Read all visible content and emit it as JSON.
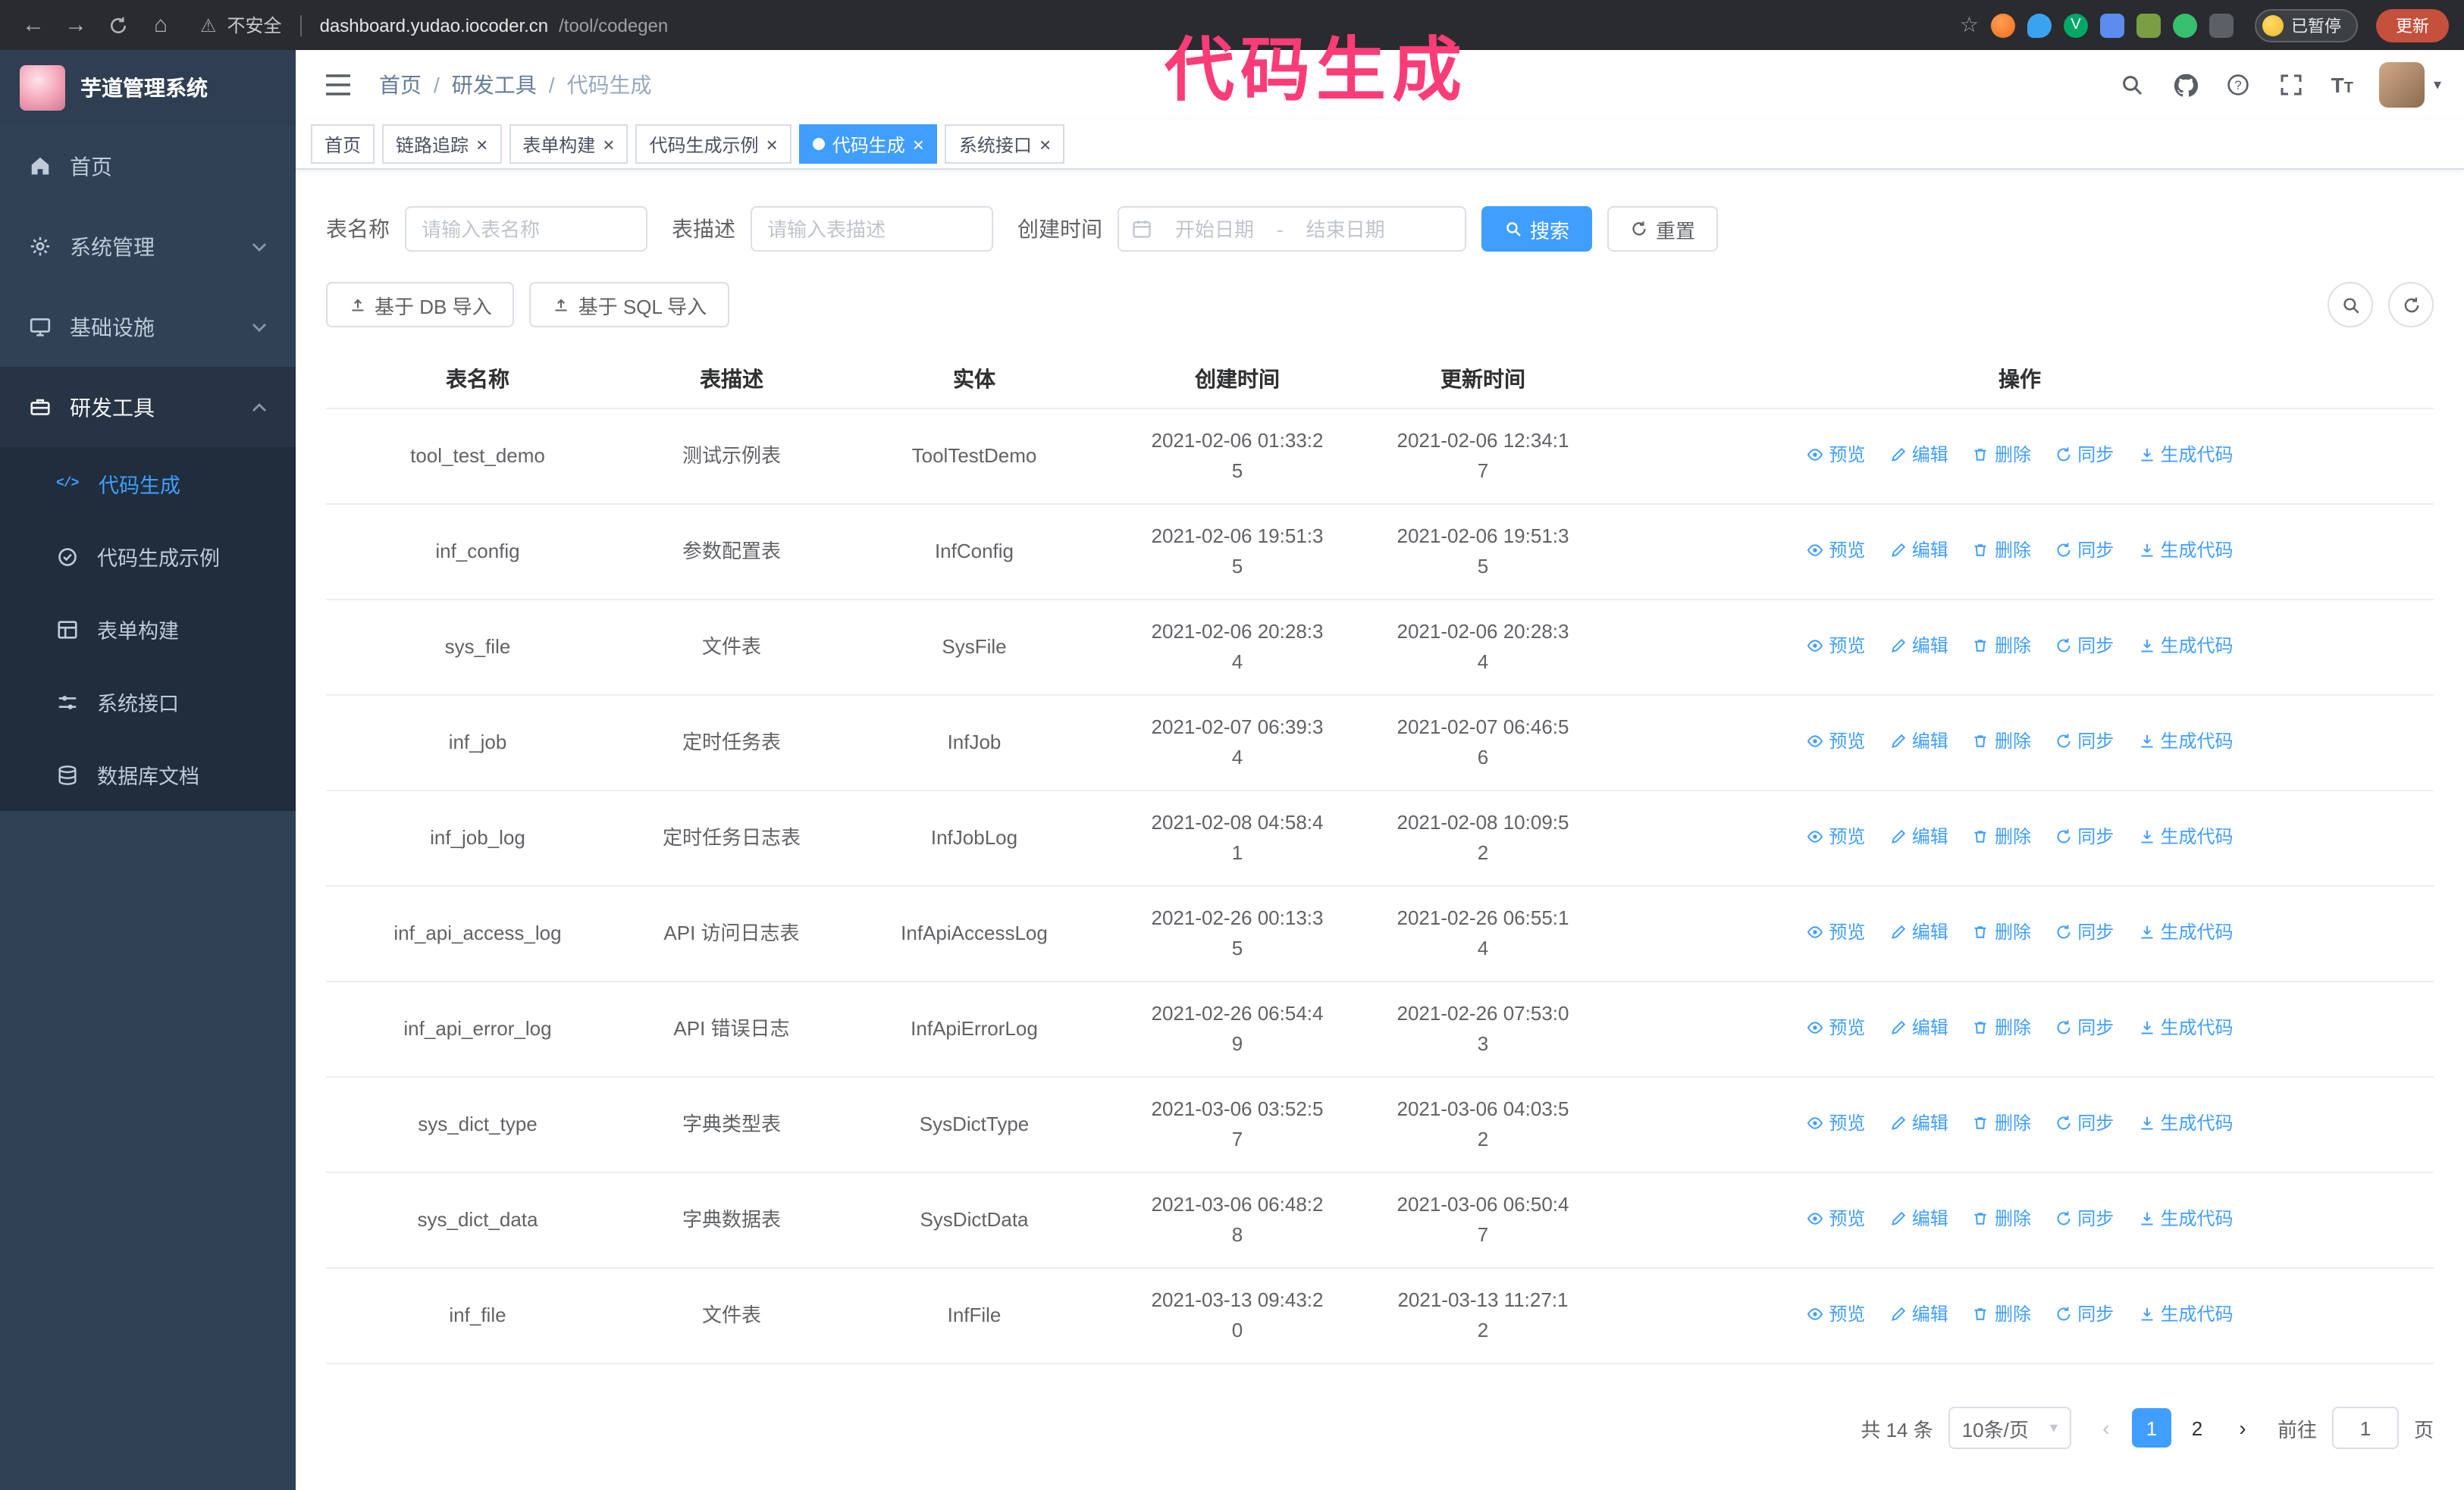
{
  "browser": {
    "security_label": "不安全",
    "url_host": "dashboard.yudao.iocoder.cn",
    "url_path": "/tool/codegen",
    "paused_badge": "已暂停",
    "update_button": "更新"
  },
  "annotation": {
    "text": "代码生成",
    "color": "#fb3c77"
  },
  "sidebar": {
    "logo_title": "芋道管理系统",
    "items": [
      {
        "label": "首页",
        "icon": "home-icon"
      },
      {
        "label": "系统管理",
        "icon": "gear-icon"
      },
      {
        "label": "基础设施",
        "icon": "monitor-icon"
      },
      {
        "label": "研发工具",
        "icon": "tools-icon",
        "expanded": true
      }
    ],
    "submenu": [
      {
        "label": "代码生成",
        "icon": "code-icon",
        "active": true
      },
      {
        "label": "代码生成示例",
        "icon": "example-icon"
      },
      {
        "label": "表单构建",
        "icon": "form-icon"
      },
      {
        "label": "系统接口",
        "icon": "api-icon"
      },
      {
        "label": "数据库文档",
        "icon": "database-icon"
      }
    ]
  },
  "header": {
    "breadcrumb": [
      "首页",
      "研发工具",
      "代码生成"
    ],
    "icons": [
      "search-icon",
      "github-icon",
      "help-icon",
      "fullscreen-icon",
      "font-size-icon",
      "avatar"
    ]
  },
  "tabs": [
    {
      "label": "首页",
      "closable": false,
      "active": false
    },
    {
      "label": "链路追踪",
      "closable": true,
      "active": false
    },
    {
      "label": "表单构建",
      "closable": true,
      "active": false
    },
    {
      "label": "代码生成示例",
      "closable": true,
      "active": false
    },
    {
      "label": "代码生成",
      "closable": true,
      "active": true
    },
    {
      "label": "系统接口",
      "closable": true,
      "active": false
    }
  ],
  "filter": {
    "table_name_label": "表名称",
    "table_name_placeholder": "请输入表名称",
    "table_desc_label": "表描述",
    "table_desc_placeholder": "请输入表描述",
    "create_time_label": "创建时间",
    "date_start_placeholder": "开始日期",
    "date_separator": "-",
    "date_end_placeholder": "结束日期",
    "search_button": "搜索",
    "reset_button": "重置"
  },
  "toolbar": {
    "import_db_button": "基于 DB 导入",
    "import_sql_button": "基于 SQL 导入"
  },
  "table": {
    "columns": [
      "表名称",
      "表描述",
      "实体",
      "创建时间",
      "更新时间",
      "操作"
    ],
    "actions": [
      "预览",
      "编辑",
      "删除",
      "同步",
      "生成代码"
    ],
    "rows": [
      [
        "tool_test_demo",
        "测试示例表",
        "ToolTestDemo",
        "2021-02-06 01:33:25",
        "2021-02-06 12:34:17"
      ],
      [
        "inf_config",
        "参数配置表",
        "InfConfig",
        "2021-02-06 19:51:35",
        "2021-02-06 19:51:35"
      ],
      [
        "sys_file",
        "文件表",
        "SysFile",
        "2021-02-06 20:28:34",
        "2021-02-06 20:28:34"
      ],
      [
        "inf_job",
        "定时任务表",
        "InfJob",
        "2021-02-07 06:39:34",
        "2021-02-07 06:46:56"
      ],
      [
        "inf_job_log",
        "定时任务日志表",
        "InfJobLog",
        "2021-02-08 04:58:41",
        "2021-02-08 10:09:52"
      ],
      [
        "inf_api_access_log",
        "API 访问日志表",
        "InfApiAccessLog",
        "2021-02-26 00:13:35",
        "2021-02-26 06:55:14"
      ],
      [
        "inf_api_error_log",
        "API 错误日志",
        "InfApiErrorLog",
        "2021-02-26 06:54:49",
        "2021-02-26 07:53:03"
      ],
      [
        "sys_dict_type",
        "字典类型表",
        "SysDictType",
        "2021-03-06 03:52:57",
        "2021-03-06 04:03:52"
      ],
      [
        "sys_dict_data",
        "字典数据表",
        "SysDictData",
        "2021-03-06 06:48:28",
        "2021-03-06 06:50:47"
      ],
      [
        "inf_file",
        "文件表",
        "InfFile",
        "2021-03-13 09:43:20",
        "2021-03-13 11:27:12"
      ]
    ]
  },
  "pagination": {
    "total_text": "共 14 条",
    "page_size": "10条/页",
    "pages": [
      "1",
      "2"
    ],
    "active_page": "1",
    "goto_label": "前往",
    "goto_value": "1",
    "goto_unit": "页"
  },
  "colors": {
    "accent": "#409eff",
    "sidebar_bg": "#304156",
    "submenu_bg": "#1f2d3d",
    "browser_bar_bg": "#2a2b2e",
    "annotation": "#fb3c77"
  }
}
